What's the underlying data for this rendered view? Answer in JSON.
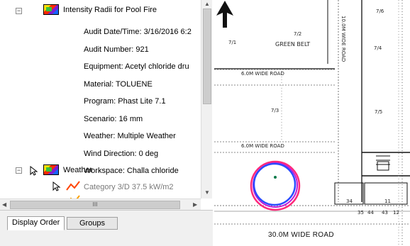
{
  "tree": {
    "intensity_layer": {
      "label": "Intensity Radii for Pool Fire",
      "expander": "⊟",
      "details": [
        "Audit Date/Time: 3/16/2016 6:2",
        "Audit Number: 921",
        "Equipment: Acetyl chloride dru",
        "Material: TOLUENE",
        "Program: Phast Lite 7.1",
        "Scenario: 16 mm",
        "Weather: Multiple Weather",
        "Wind Direction: 0 deg",
        "Workspace: Challa chloride"
      ]
    },
    "weather_layer": {
      "label": "Weather",
      "expander": "⊟",
      "children": [
        {
          "label": "Category 3/D 37.5 kW/m2",
          "color": "#ff4500"
        }
      ]
    }
  },
  "hscroll_grip": "III",
  "tabs": [
    {
      "label": "Display Order",
      "active": true
    },
    {
      "label": "Groups",
      "active": false
    }
  ],
  "map": {
    "labels": {
      "green_belt": "GREEN BELT",
      "green_belt_code": "7/2",
      "road_6m": "6.0M WIDE ROAD",
      "road_6m_2": "6.0M WIDE ROAD",
      "road_30m": "30.0M WIDE ROAD",
      "road_v": "10.0M WIDE ROAD",
      "plot_a": "7/1",
      "plot_b": "7/3",
      "plot_c": "7/4",
      "plot_d": "7/5",
      "plot_e": "7/6",
      "small_1": "34",
      "small_2": "35",
      "small_3": "44",
      "small_4": "43",
      "small_5": "12",
      "small_6": "11"
    },
    "circle_colors": {
      "outer": "#ff2a7a",
      "middle": "#c01ad8",
      "inner": "#2a4cff"
    }
  }
}
